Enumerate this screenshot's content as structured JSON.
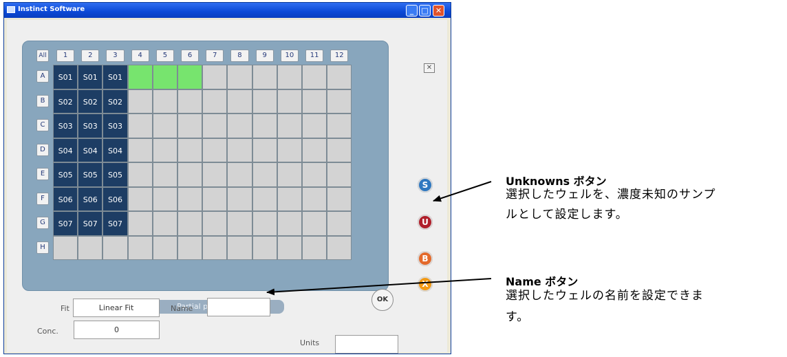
{
  "window": {
    "title": "Instinct Software",
    "minimize": "_",
    "maximize": "□",
    "close": "✕"
  },
  "plate": {
    "corner_label": "All",
    "columns": [
      "1",
      "2",
      "3",
      "4",
      "5",
      "6",
      "7",
      "8",
      "9",
      "10",
      "11",
      "12"
    ],
    "rows": [
      "A",
      "B",
      "C",
      "D",
      "E",
      "F",
      "G",
      "H"
    ],
    "wells": [
      [
        "S01",
        "S01",
        "S01",
        "",
        "",
        "",
        "",
        "",
        "",
        "",
        "",
        ""
      ],
      [
        "S02",
        "S02",
        "S02",
        "",
        "",
        "",
        "",
        "",
        "",
        "",
        "",
        ""
      ],
      [
        "S03",
        "S03",
        "S03",
        "",
        "",
        "",
        "",
        "",
        "",
        "",
        "",
        ""
      ],
      [
        "S04",
        "S04",
        "S04",
        "",
        "",
        "",
        "",
        "",
        "",
        "",
        "",
        ""
      ],
      [
        "S05",
        "S05",
        "S05",
        "",
        "",
        "",
        "",
        "",
        "",
        "",
        "",
        ""
      ],
      [
        "S06",
        "S06",
        "S06",
        "",
        "",
        "",
        "",
        "",
        "",
        "",
        "",
        ""
      ],
      [
        "S07",
        "S07",
        "S07",
        "",
        "",
        "",
        "",
        "",
        "",
        "",
        "",
        ""
      ],
      [
        "",
        "",
        "",
        "",
        "",
        "",
        "",
        "",
        "",
        "",
        "",
        ""
      ]
    ],
    "status": "Partial plate selected",
    "ok": "OK",
    "close_small": "✕"
  },
  "side_buttons": [
    {
      "name": "standards",
      "label": "S",
      "color": "#2f78c0"
    },
    {
      "name": "unknowns",
      "label": "U",
      "color": "#b01e2a"
    },
    {
      "name": "blanks",
      "label": "B",
      "color": "#e4692a"
    },
    {
      "name": "clear",
      "label": "X",
      "color": "#f39a14"
    }
  ],
  "form": {
    "fit_label": "Fit",
    "fit_value": "Linear Fit",
    "name_label": "Name",
    "name_value": "",
    "conc_label": "Conc.",
    "conc_value": "0",
    "units_label": "Units",
    "units_value": ""
  },
  "annotations": {
    "unknowns_title": "Unknowns ボタン",
    "unknowns_line1": "選択したウェルを、濃度未知のサンプ",
    "unknowns_line2": "ルとして設定します。",
    "name_title": "Name ボタン",
    "name_line1": "選択したウェルの名前を設定できま",
    "name_line2": "す。"
  },
  "colors": {
    "selected_well": "#1d3d64",
    "highlight_well": "#77e46e",
    "empty_well": "#d3d3d3"
  }
}
